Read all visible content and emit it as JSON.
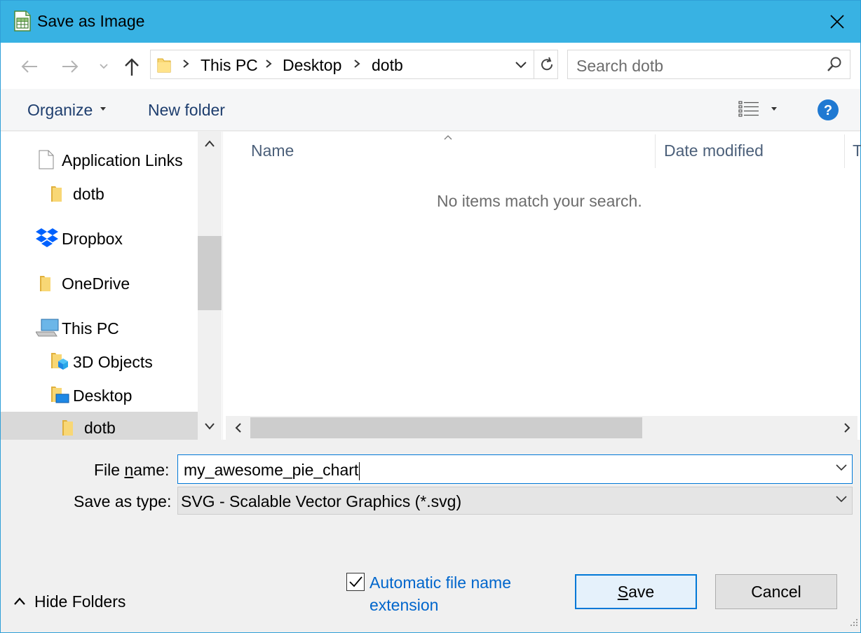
{
  "window": {
    "title": "Save as Image",
    "title_icon": "spreadsheet-app-icon",
    "close_icon": "close-icon"
  },
  "nav": {
    "back_icon": "back-arrow-icon",
    "forward_icon": "forward-arrow-icon",
    "recent_icon": "chevron-down-icon",
    "up_icon": "up-arrow-icon",
    "breadcrumb": [
      "This PC",
      "Desktop",
      "dotb"
    ],
    "refresh_icon": "refresh-icon",
    "search_placeholder": "Search dotb"
  },
  "toolbar": {
    "organize_label": "Organize",
    "new_folder_label": "New folder",
    "view_icon": "details-view-icon",
    "help_icon": "help-icon",
    "help_glyph": "?"
  },
  "sidebar": {
    "items": [
      {
        "label": "Application Links",
        "icon": "document-icon"
      },
      {
        "label": "dotb",
        "icon": "folder-icon"
      },
      {
        "label": "Dropbox",
        "icon": "dropbox-icon"
      },
      {
        "label": "OneDrive",
        "icon": "folder-icon"
      },
      {
        "label": "This PC",
        "icon": "computer-icon"
      },
      {
        "label": "3D Objects",
        "icon": "3d-objects-folder-icon"
      },
      {
        "label": "Desktop",
        "icon": "desktop-folder-icon"
      },
      {
        "label": "dotb",
        "icon": "folder-icon",
        "selected": true
      }
    ]
  },
  "content": {
    "columns": [
      "Name",
      "Date modified",
      "T"
    ],
    "sorted_column": "Name",
    "empty_message": "No items match your search."
  },
  "form": {
    "filename_label_pre": "File ",
    "filename_label_accel": "n",
    "filename_label_post": "ame:",
    "filename_value": "my_awesome_pie_chart",
    "savetype_label": "Save as type:",
    "savetype_value": "SVG - Scalable Vector Graphics (*.svg)"
  },
  "footer": {
    "hide_folders_label": "Hide Folders",
    "auto_extension_label": "Automatic file name extension",
    "auto_extension_checked": true,
    "save_accel": "S",
    "save_rest": "ave",
    "cancel_label": "Cancel"
  },
  "colors": {
    "titlebar": "#38b2e3",
    "accent": "#0078d7",
    "link": "#0066cc",
    "help_circle": "#1f79d2",
    "folder": "#f8d775",
    "selected_row": "#d9d9d9"
  }
}
